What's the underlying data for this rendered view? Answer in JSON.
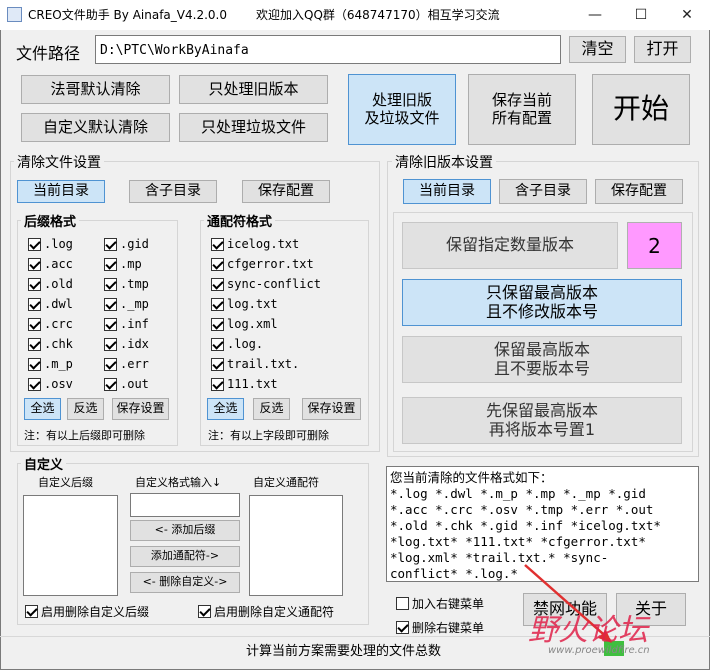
{
  "window": {
    "title": "CREO文件助手 By Ainafa_V4.2.0.0",
    "center_text": "欢迎加入QQ群（648747170）相互学习交流",
    "minimize": "—",
    "maximize": "☐",
    "close": "✕"
  },
  "path_row": {
    "label": "文件路径",
    "value": "D:\\PTC\\WorkByAinafa",
    "clear": "清空",
    "open": "打开"
  },
  "top_buttons": {
    "fage_default_clean": "法哥默认清除",
    "only_old_versions": "只处理旧版本",
    "custom_default_clean": "自定义默认清除",
    "only_junk": "只处理垃圾文件",
    "old_and_junk": "处理旧版\n及垃圾文件",
    "save_config": "保存当前\n所有配置",
    "start": "开始"
  },
  "clean_files": {
    "title": "清除文件设置",
    "tabs": {
      "current_dir": "当前目录",
      "sub_dirs": "含子目录",
      "save": "保存配置"
    },
    "suffix": {
      "title": "后缀格式",
      "col1": [
        ".log",
        ".acc",
        ".old",
        ".dwl",
        ".crc",
        ".chk",
        ".m_p",
        ".osv"
      ],
      "col2": [
        ".gid",
        ".mp",
        ".tmp",
        "._mp",
        ".inf",
        ".idx",
        ".err",
        ".out"
      ],
      "select_all": "全选",
      "invert": "反选",
      "save": "保存设置",
      "note": "注：有以上后缀即可删除"
    },
    "wildcard": {
      "title": "通配符格式",
      "items": [
        "icelog.txt",
        "cfgerror.txt",
        "sync-conflict",
        "log.txt",
        "log.xml",
        ".log.",
        "trail.txt.",
        "111.txt"
      ],
      "select_all": "全选",
      "invert": "反选",
      "save": "保存设置",
      "note": "注：有以上字段即可删除"
    }
  },
  "custom": {
    "title": "自定义",
    "suffix_label": "自定义后缀",
    "input_label": "自定义格式输入↓",
    "wildcard_label": "自定义通配符",
    "add_suffix": "<- 添加后缀",
    "add_wildcard": "添加通配符->",
    "delete_custom": "<- 删除自定义->",
    "enable_suffix": "启用删除自定义后缀",
    "enable_wildcard": "启用删除自定义通配符"
  },
  "old_versions": {
    "title": "清除旧版本设置",
    "tabs": {
      "current_dir": "当前目录",
      "sub_dirs": "含子目录",
      "save": "保存配置"
    },
    "keep_count": "保留指定数量版本",
    "count_value": "2",
    "keep_highest_no_change": "只保留最高版本\n且不修改版本号",
    "keep_highest_no_ver": "保留最高版本\n且不要版本号",
    "keep_then_reset": "先保留最高版本\n再将版本号置1"
  },
  "summary": {
    "text": "您当前清除的文件格式如下：\n*.log *.dwl *.m_p *.mp *._mp *.gid\n*.acc *.crc *.osv *.tmp *.err *.out\n*.old *.chk *.gid *.inf *icelog.txt*\n*log.txt* *111.txt* *cfgerror.txt*\n*log.xml* *trail.txt.* *sync-\nconflict* *.log.*"
  },
  "context_menu": {
    "add": "加入右键菜单",
    "delete": "删除右键菜单"
  },
  "bottom": {
    "disable_button": "禁网功能",
    "about_button": "关于",
    "status": "计算当前方案需要处理的文件总数"
  },
  "watermark": {
    "text": "野火论坛",
    "url": "www.proewildfire.cn"
  }
}
